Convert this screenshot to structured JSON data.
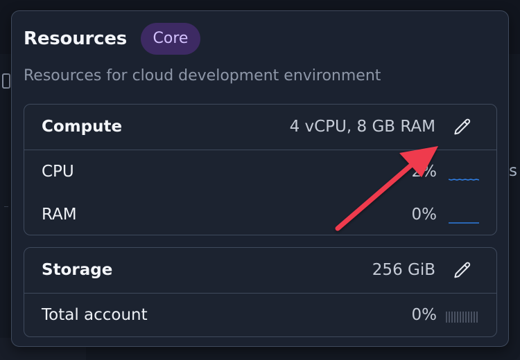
{
  "header": {
    "title": "Resources",
    "badge": "Core",
    "subtitle": "Resources for cloud development environment"
  },
  "compute": {
    "label": "Compute",
    "value": "4 vCPU, 8 GB RAM",
    "rows": [
      {
        "label": "CPU",
        "value": "2%"
      },
      {
        "label": "RAM",
        "value": "0%"
      }
    ]
  },
  "storage": {
    "label": "Storage",
    "value": "256 GiB",
    "rows": [
      {
        "label": "Total account",
        "value": "0%"
      }
    ]
  },
  "background": {
    "edge_text": "s"
  },
  "icons": {
    "edit": "pencil-icon",
    "arrow": "red-arrow-annotation"
  },
  "colors": {
    "badge_bg": "#3d2a63",
    "badge_text": "#d4c2ff",
    "spark_line": "#2f7de1",
    "annotation_arrow": "#ef3b4e"
  }
}
